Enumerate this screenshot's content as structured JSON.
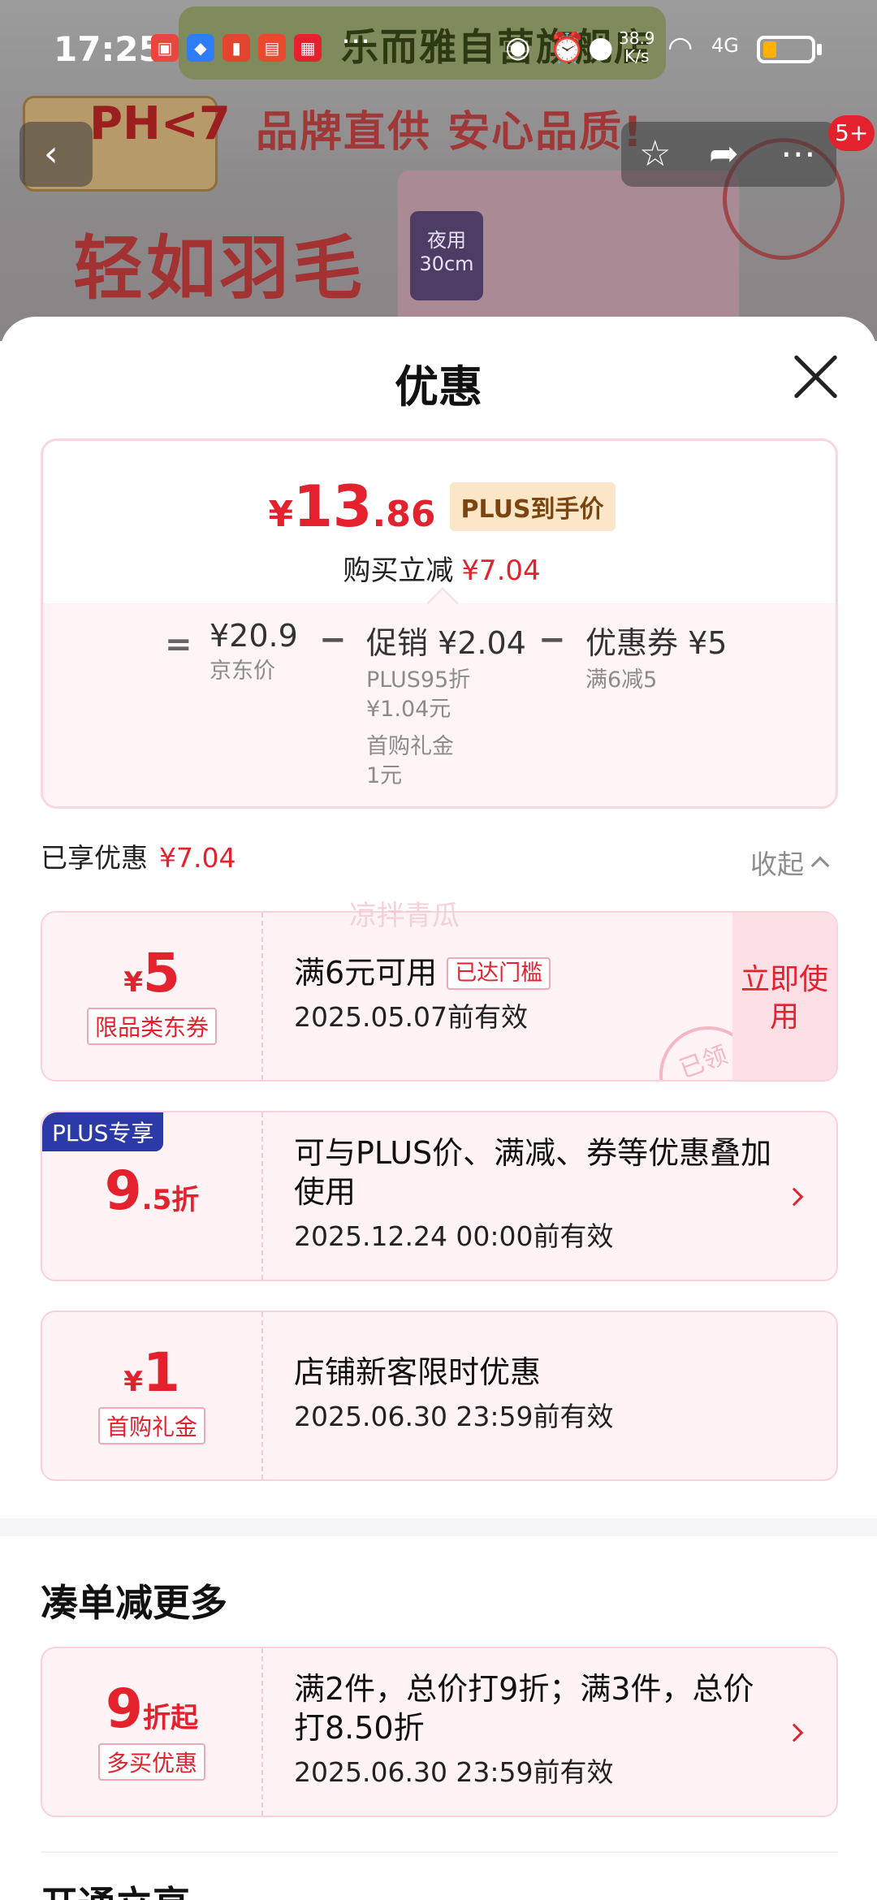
{
  "status_bar": {
    "time": "17:25",
    "network_speed_value": "38.9",
    "network_speed_unit": "K/s",
    "signal": "4G"
  },
  "background": {
    "store_name": "乐而雅自营旗舰店",
    "ph_tag": "PH<7",
    "slogan": "品牌直供 安心品质!",
    "headline": "轻如羽毛",
    "pack_label": "夜用 30cm",
    "badge_count": "5+"
  },
  "sheet": {
    "title": "优惠",
    "price_summary": {
      "currency": "¥",
      "final_int": "13",
      "final_dec": ".86",
      "plus_tag": "PLUS到手价",
      "saving_label": "购买立减",
      "saving_value": "¥7.04",
      "calc": {
        "equals": "=",
        "jd_price": "¥20.9",
        "jd_price_label": "京东价",
        "minus": "−",
        "promo": "促销 ¥2.04",
        "promo_detail_1": "PLUS95折",
        "promo_detail_2": "¥1.04元",
        "promo_detail_3": "首购礼金",
        "promo_detail_4": "1元",
        "coupon": "优惠券 ¥5",
        "coupon_detail": "满6减5"
      }
    },
    "enjoyed": {
      "label": "已享优惠",
      "value": "¥7.04",
      "collapse": "收起"
    },
    "watermark": "凉拌青瓜",
    "coupons": [
      {
        "yen": "¥",
        "amount": "5",
        "label": "限品类东券",
        "title": "满6元可用",
        "threshold": "已达门槛",
        "date": "2025.05.07前有效",
        "action": "立即使用",
        "stamp": "已领"
      },
      {
        "corner": "PLUS专享",
        "amount": "9",
        "suffix": ".5折",
        "title": "可与PLUS价、满减、券等优惠叠加使用",
        "date": "2025.12.24 00:00前有效"
      },
      {
        "yen": "¥",
        "amount": "1",
        "label": "首购礼金",
        "title": "店铺新客限时优惠",
        "date": "2025.06.30 23:59前有效"
      }
    ],
    "more_section": {
      "title": "凑单减更多",
      "card": {
        "amount": "9",
        "suffix": "折起",
        "label": "多买优惠",
        "title": "满2件，总价打9折；满3件，总价打8.50折",
        "date": "2025.06.30 23:59前有效"
      }
    },
    "next_section_title": "开通立享"
  },
  "colors": {
    "accent_red": "#e3222e",
    "plus_blue": "#2b3aa6",
    "card_pink": "#fff3f5"
  }
}
